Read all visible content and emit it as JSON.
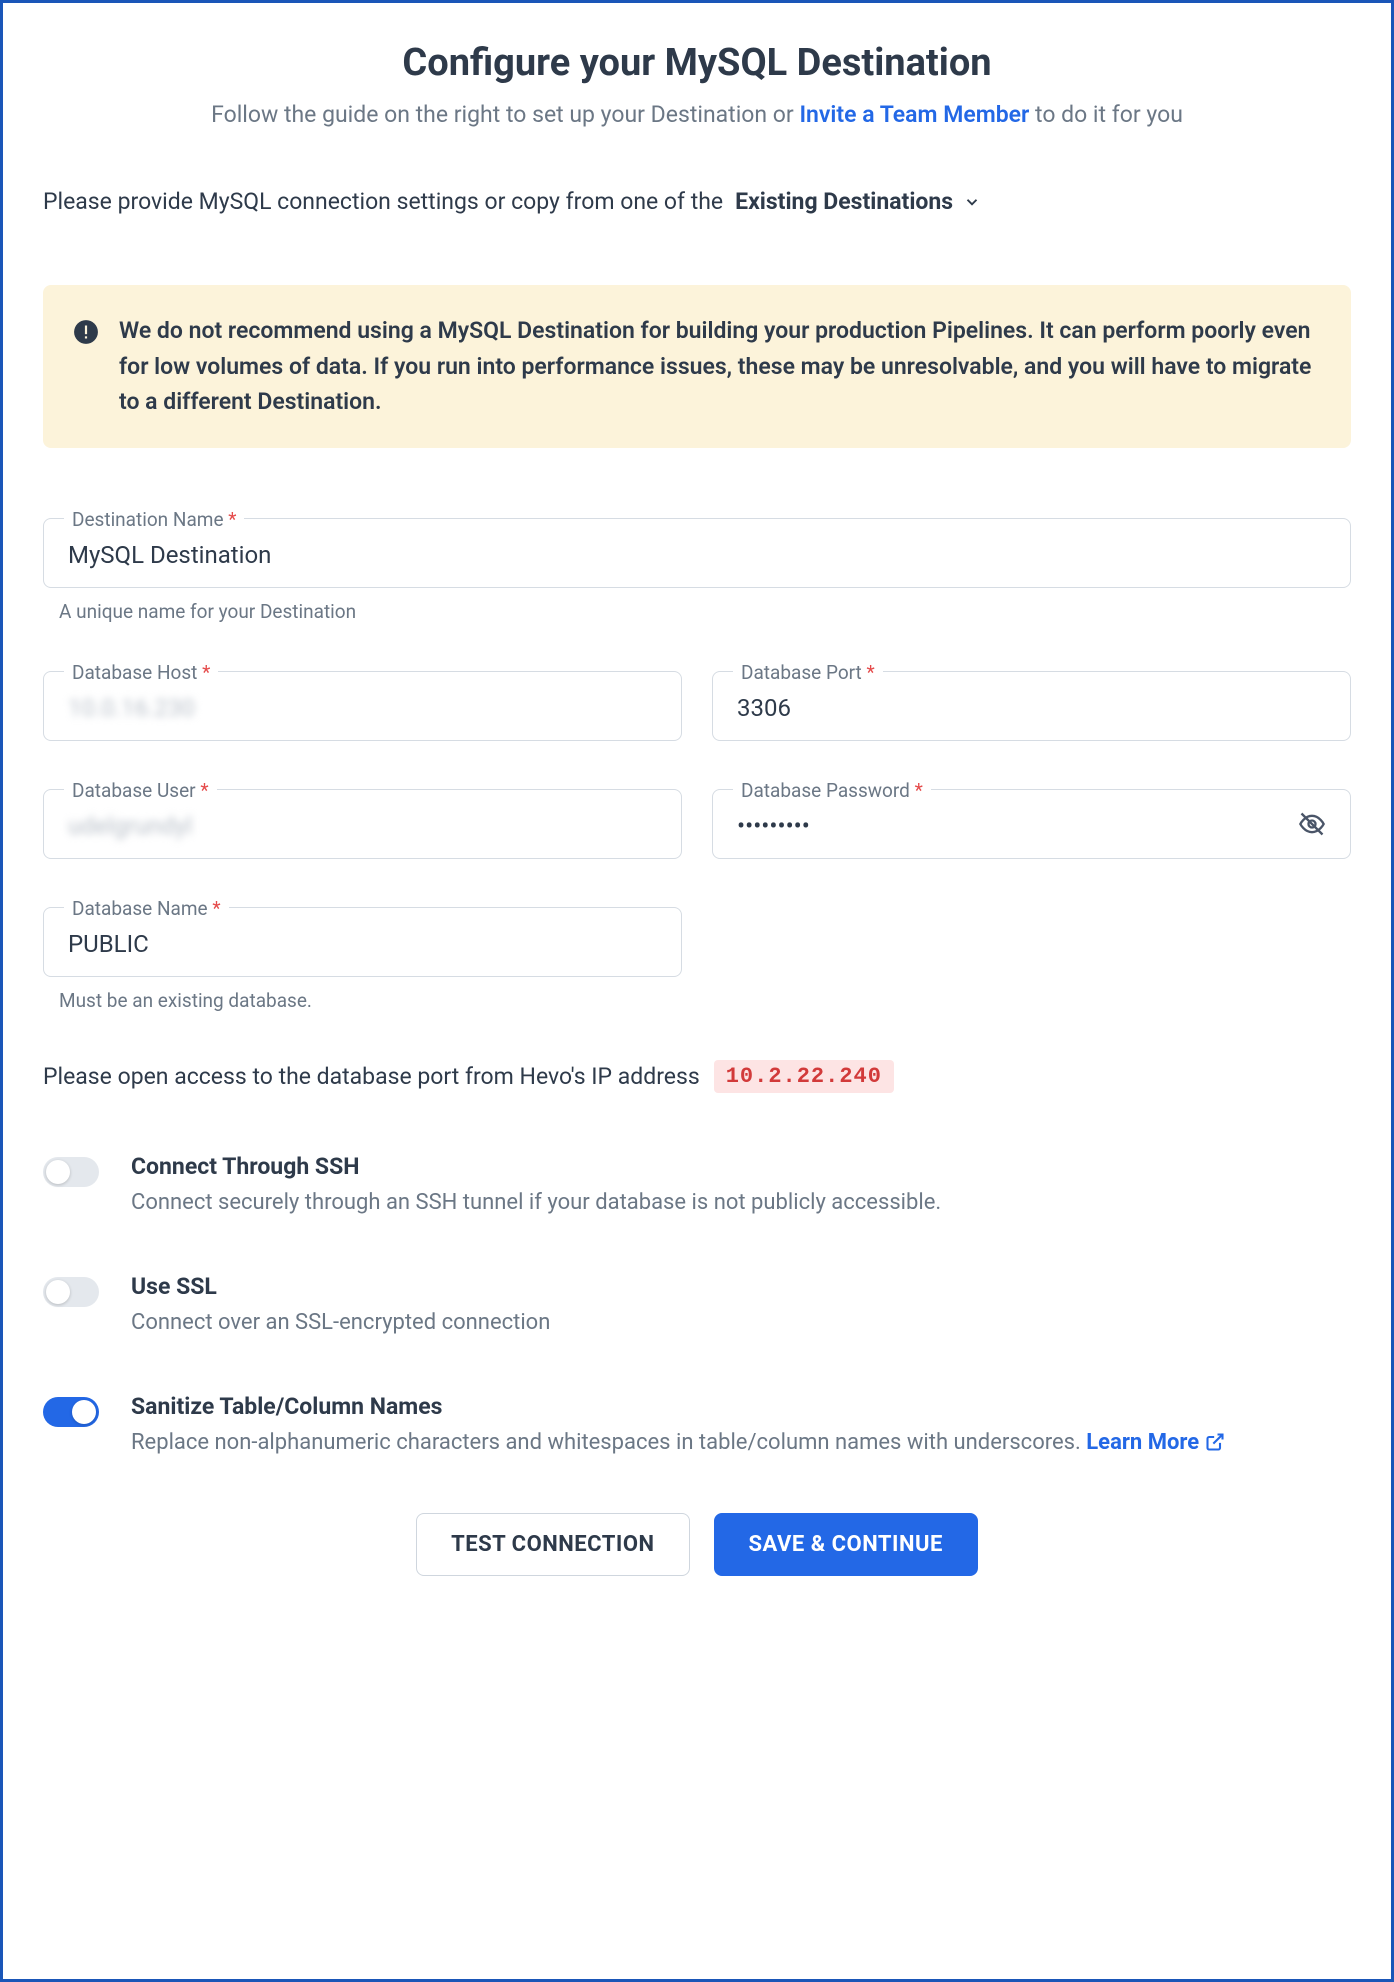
{
  "header": {
    "title": "Configure your MySQL Destination",
    "subtitle_prefix": "Follow the guide on the right to set up your Destination or ",
    "subtitle_link": "Invite a Team Member",
    "subtitle_suffix": " to do it for you"
  },
  "intro": {
    "text": "Please provide MySQL connection settings or copy from one of the",
    "dropdown_label": "Existing Destinations"
  },
  "warning": {
    "text": "We do not recommend using a MySQL Destination for building your production Pipelines. It can perform poorly even for low volumes of data. If you run into performance issues, these may be unresolvable, and you will have to migrate to a different Destination."
  },
  "fields": {
    "destination_name": {
      "label": "Destination Name",
      "required": "*",
      "value": "MySQL Destination",
      "help": "A unique name for your Destination"
    },
    "database_host": {
      "label": "Database Host",
      "required": "*",
      "value": "10.0.16.230"
    },
    "database_port": {
      "label": "Database Port",
      "required": "*",
      "value": "3306"
    },
    "database_user": {
      "label": "Database User",
      "required": "*",
      "value": "udelgrundyl"
    },
    "database_password": {
      "label": "Database Password",
      "required": "*",
      "value": "•••••••••"
    },
    "database_name": {
      "label": "Database Name",
      "required": "*",
      "value": "PUBLIC",
      "help": "Must be an existing database."
    }
  },
  "ip_access": {
    "text": "Please open access to the database port from Hevo's IP address",
    "ip": "10.2.22.240"
  },
  "toggles": {
    "ssh": {
      "title": "Connect Through SSH",
      "desc": "Connect securely through an SSH tunnel if your database is not publicly accessible.",
      "on": false
    },
    "ssl": {
      "title": "Use SSL",
      "desc": "Connect over an SSL-encrypted connection",
      "on": false
    },
    "sanitize": {
      "title": "Sanitize Table/Column Names",
      "desc": "Replace non-alphanumeric characters and whitespaces in table/column names with underscores. ",
      "learn_more": "Learn More",
      "on": true
    }
  },
  "buttons": {
    "test": "TEST CONNECTION",
    "save": "SAVE & CONTINUE"
  }
}
